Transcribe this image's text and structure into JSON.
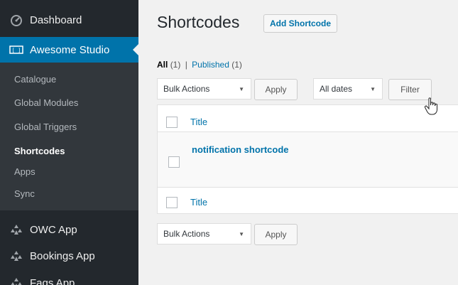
{
  "sidebar": {
    "dashboard": {
      "label": "Dashboard",
      "icon": "dashboard-icon"
    },
    "active": {
      "label": "Awesome Studio",
      "icon": "shortcode-icon"
    },
    "submenu": [
      "Catalogue",
      "Global Modules",
      "Global Triggers",
      "Shortcodes",
      "Apps",
      "Sync"
    ],
    "current_submenu": "Shortcodes",
    "apps": [
      {
        "label": "OWC App",
        "icon": "apps-icon"
      },
      {
        "label": "Bookings App",
        "icon": "apps-icon"
      },
      {
        "label": "Faqs App",
        "icon": "apps-icon"
      }
    ]
  },
  "header": {
    "title": "Shortcodes",
    "add_button": "Add Shortcode"
  },
  "filters": {
    "all_label": "All",
    "all_count": "(1)",
    "separator": "|",
    "published_label": "Published",
    "published_count": "(1)"
  },
  "toolbar_top": {
    "bulk_actions": "Bulk Actions",
    "apply": "Apply",
    "dates": "All dates",
    "filter": "Filter"
  },
  "table": {
    "column_title": "Title",
    "rows": [
      {
        "title": "notification shortcode"
      }
    ]
  },
  "toolbar_bottom": {
    "bulk_actions": "Bulk Actions",
    "apply": "Apply"
  },
  "colors": {
    "sidebar": "#23282d",
    "submenu": "#32373c",
    "accent": "#0073aa",
    "background": "#f1f1f1"
  }
}
